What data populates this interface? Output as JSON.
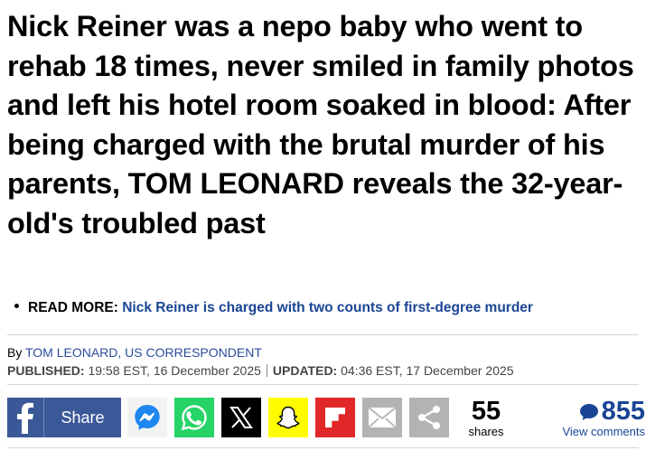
{
  "headline": "Nick Reiner was a nepo baby who went to rehab 18 times, never smiled in family photos and left his hotel room soaked in blood: After being charged with the brutal murder of his parents, TOM LEONARD reveals the 32-year-old's troubled past",
  "read_more": {
    "label": "READ MORE:",
    "link_text": "Nick Reiner is charged with two counts of first-degree murder"
  },
  "byline": {
    "prefix": "By",
    "author": "TOM LEONARD, US CORRESPONDENT"
  },
  "dates": {
    "published_label": "PUBLISHED:",
    "published_value": "19:58 EST, 16 December 2025",
    "updated_label": "UPDATED:",
    "updated_value": "04:36 EST, 17 December 2025"
  },
  "share": {
    "facebook_label": "Share",
    "share_count": "55",
    "share_count_label": "shares",
    "comment_count": "855",
    "comment_label": "View comments"
  },
  "colors": {
    "facebook": "#3b5998",
    "whatsapp": "#25d366",
    "snapchat": "#fffc00",
    "flipboard": "#e12828",
    "link_blue": "#1a4594"
  },
  "icons": [
    "facebook-icon",
    "messenger-icon",
    "whatsapp-icon",
    "x-icon",
    "snapchat-icon",
    "flipboard-icon",
    "email-icon",
    "share-more-icon",
    "comment-bubble-icon"
  ]
}
